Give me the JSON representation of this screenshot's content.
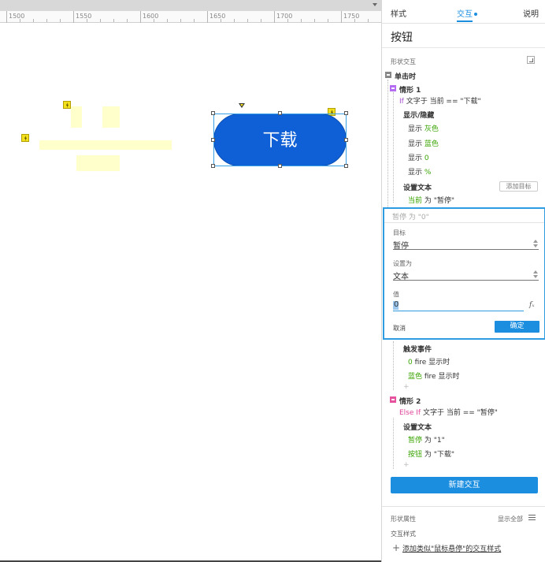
{
  "ruler": {
    "labels": [
      "1500",
      "1550",
      "1600",
      "1650",
      "1700",
      "1750"
    ]
  },
  "canvas": {
    "button_text": "下载"
  },
  "panel": {
    "tabs": [
      {
        "label": "样式"
      },
      {
        "label": "交互"
      },
      {
        "label": "说明"
      }
    ],
    "active_tab": "交互",
    "widget_name": "按钮",
    "section_label": "形状交互",
    "event": "单击时",
    "case1": {
      "title": "情形 1",
      "cond_if": "If",
      "cond_text": "文字于 当前 == \"下载\"",
      "action1": "显示/隐藏",
      "show_label": "显示",
      "show_items": [
        "灰色",
        "蓝色",
        "0",
        "%"
      ],
      "action2": "设置文本",
      "add_target": "添加目标",
      "set1_target": "当前",
      "set1_rest": "为 \"暂停\"",
      "set2_ghost": "暂停 为 \"0\""
    },
    "form": {
      "target_label": "目标",
      "target_value": "暂停",
      "set_as_label": "设置为",
      "set_as_value": "文本",
      "value_label": "值",
      "value_value": "0",
      "cancel": "取消",
      "ok": "确定"
    },
    "trigger": {
      "title": "触发事件",
      "items": [
        {
          "target": "0",
          "rest": "fire 显示时"
        },
        {
          "target": "蓝色",
          "rest": "fire 显示时"
        }
      ]
    },
    "case2": {
      "title": "情形 2",
      "cond_if": "Else If",
      "cond_text": "文字于 当前 == \"暂停\"",
      "action": "设置文本",
      "items": [
        {
          "target": "暂停",
          "rest": "为 \"1\""
        },
        {
          "target": "按钮",
          "rest": "为 \"下载\""
        }
      ]
    },
    "new_interaction": "新建交互",
    "shape_props": "形状属性",
    "show_all": "显示全部",
    "interaction_style": "交互样式",
    "add_style_link": "添加类似\"鼠标悬停\"的交互样式"
  },
  "colors": {
    "accent": "#1b8ee0",
    "button": "#0f5fd6",
    "green_text": "#38a300"
  }
}
